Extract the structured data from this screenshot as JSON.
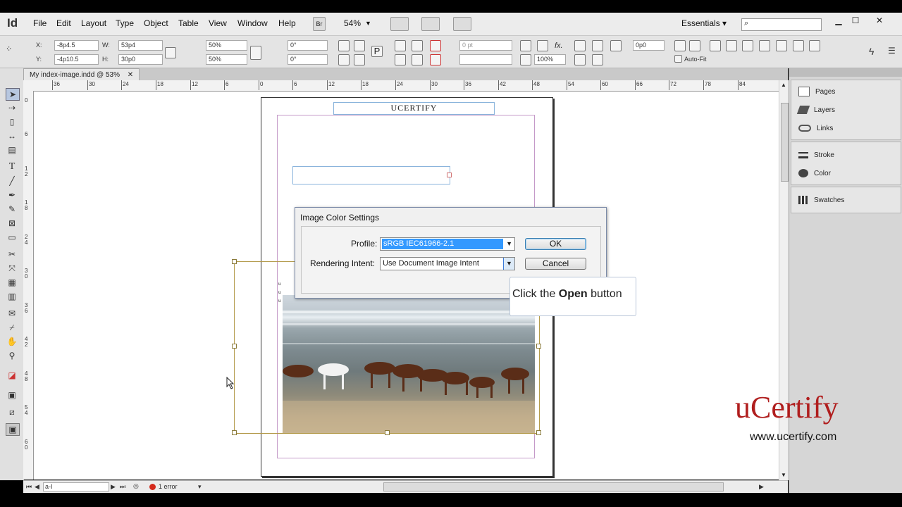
{
  "app": {
    "logo": "Id",
    "workspace": "Essentials ▾",
    "zoom": "54%",
    "bridge": "Br"
  },
  "menu": [
    "File",
    "Edit",
    "Layout",
    "Type",
    "Object",
    "Table",
    "View",
    "Window",
    "Help"
  ],
  "control": {
    "x": "-8p4.5",
    "y": "-4p10.5",
    "w": "53p4",
    "h": "30p0",
    "scale_x": "50%",
    "scale_y": "50%",
    "angle": "0°",
    "shear": "0°",
    "stroke_weight": "0 pt",
    "opacity": "100%",
    "offset": "0p0",
    "autofit": "Auto-Fit",
    "x_label": "X:",
    "y_label": "Y:",
    "w_label": "W:",
    "h_label": "H:"
  },
  "document": {
    "tab": "My index-image.indd @ 53%",
    "header_text": "UCERTIFY",
    "sidebar_letters": "u\nu\nu"
  },
  "ruler": {
    "h_ticks": [
      "36",
      "30",
      "24",
      "18",
      "12",
      "6",
      "0",
      "6",
      "12",
      "18",
      "24",
      "30",
      "36",
      "42",
      "48",
      "54",
      "60",
      "66",
      "72",
      "78",
      "84"
    ],
    "v_ticks": [
      "0",
      "6",
      "1 2",
      "1 8",
      "2 4",
      "3 0",
      "3 6",
      "4 2",
      "4 8",
      "5 4",
      "6 0"
    ]
  },
  "panels": {
    "group1": [
      "Pages",
      "Layers",
      "Links"
    ],
    "group2": [
      "Stroke",
      "Color"
    ],
    "group3": [
      "Swatches"
    ]
  },
  "dialog": {
    "title": "Image Color Settings",
    "profile_label": "Profile:",
    "profile_value": "sRGB IEC61966-2.1",
    "intent_label": "Rendering Intent:",
    "intent_value": "Use Document Image Intent",
    "ok": "OK",
    "cancel": "Cancel"
  },
  "callout": {
    "pre": "Click the ",
    "bold": "Open",
    "post": " button"
  },
  "watermark": {
    "brand": "uCertify",
    "url": "www.ucertify.com"
  },
  "status": {
    "page": "a-I",
    "errors": "1 error"
  }
}
